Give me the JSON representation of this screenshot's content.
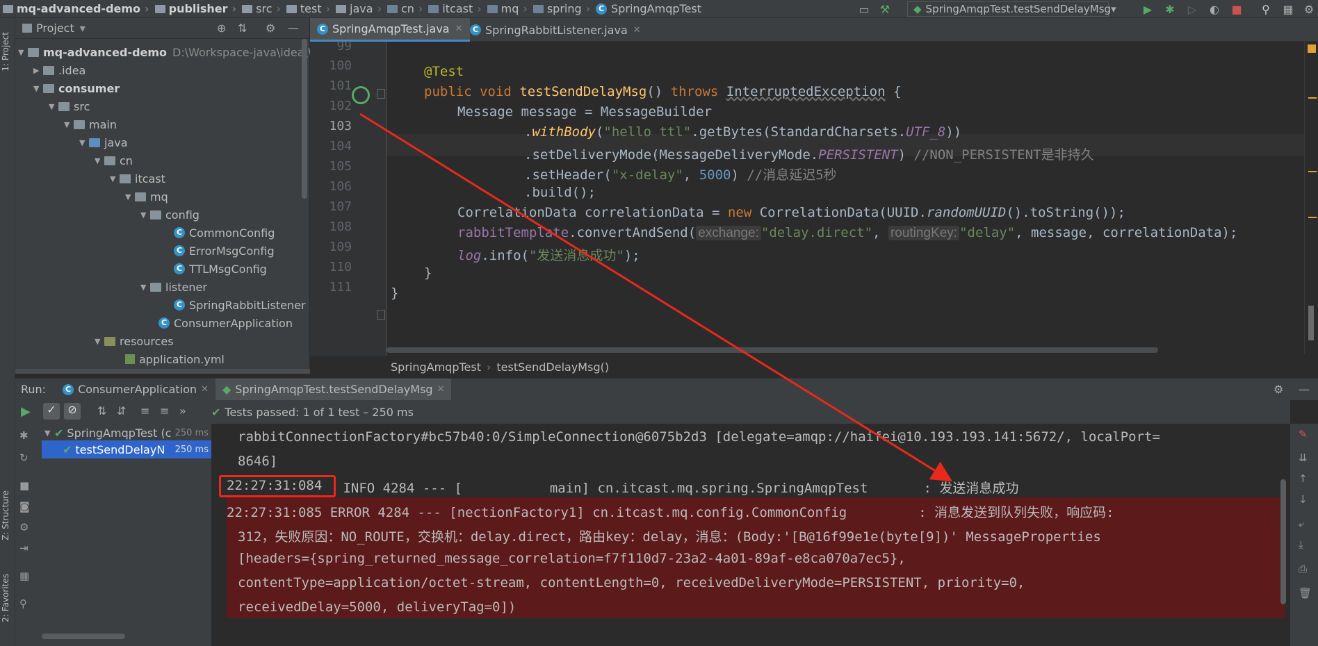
{
  "navbar": {
    "crumbs": [
      "mq-advanced-demo",
      "publisher",
      "src",
      "test",
      "java",
      "cn",
      "itcast",
      "mq",
      "spring",
      "SpringAmqpTest"
    ],
    "run_config": "SpringAmqpTest.testSendDelayMsg"
  },
  "left_strip": {
    "project": "1: Project",
    "structure": "Z: Structure",
    "favorites": "2: Favorites"
  },
  "project": {
    "title": "Project",
    "root": "mq-advanced-demo",
    "root_path": "D:\\Workspace-java\\idea\\Wor",
    "items": [
      {
        "label": ".idea"
      },
      {
        "label": "consumer"
      },
      {
        "label": "src"
      },
      {
        "label": "main"
      },
      {
        "label": "java"
      },
      {
        "label": "cn"
      },
      {
        "label": "itcast"
      },
      {
        "label": "mq"
      },
      {
        "label": "config"
      },
      {
        "label": "CommonConfig"
      },
      {
        "label": "ErrorMsgConfig"
      },
      {
        "label": "TTLMsgConfig"
      },
      {
        "label": "listener"
      },
      {
        "label": "SpringRabbitListener"
      },
      {
        "label": "ConsumerApplication"
      },
      {
        "label": "resources"
      },
      {
        "label": "application.yml"
      }
    ]
  },
  "editor": {
    "tabs": [
      "SpringAmqpTest.java",
      "SpringRabbitListener.java"
    ],
    "line_numbers": [
      "99",
      "100",
      "101",
      "102",
      "103",
      "104",
      "105",
      "106",
      "107",
      "108",
      "109",
      "110",
      "111"
    ],
    "code": {
      "l100": "@Test",
      "l101_public": "public",
      "l101_void": "void",
      "l101_name": "testSendDelayMsg",
      "l101_paren": "()",
      "l101_throws": "throws",
      "l101_exc": "InterruptedException",
      "l101_brace": "{",
      "l102": "Message message = MessageBuilder",
      "l103_a": ".",
      "l103_withBody": "withBody",
      "l103_b": "(",
      "l103_str": "\"hello ttl\"",
      "l103_c": ".getBytes(StandardCharsets.",
      "l103_utf": "UTF_8",
      "l103_d": "))",
      "l104_a": ".setDeliveryMode(MessageDeliveryMode.",
      "l104_const": "PERSISTENT",
      "l104_b": ")",
      "l104_cmt": "//NON_PERSISTENT是非持久",
      "l105_a": ".setHeader(",
      "l105_str": "\"x-delay\"",
      "l105_b": ", ",
      "l105_num": "5000",
      "l105_c": ")",
      "l105_cmt": "//消息延迟5秒",
      "l106": ".build();",
      "l107_a": "CorrelationData correlationData = ",
      "l107_new": "new",
      "l107_b": " CorrelationData(UUID.",
      "l107_m": "randomUUID",
      "l107_c": "().toString());",
      "l108_field": "rabbitTemplate",
      "l108_a": ".convertAndSend(",
      "l108_hint1": "exchange:",
      "l108_str1": "\"delay.direct\"",
      "l108_b": ",",
      "l108_hint2": "routingKey:",
      "l108_str2": "\"delay\"",
      "l108_c": ", message, correlationData);",
      "l109_log": "log",
      "l109_a": ".info(",
      "l109_str": "\"发送消息成功\"",
      "l109_b": ");",
      "l110": "}",
      "l111": "}"
    },
    "breadcrumb": [
      "SpringAmqpTest",
      "testSendDelayMsg()"
    ]
  },
  "run": {
    "label": "Run:",
    "tabs": [
      "ConsumerApplication",
      "SpringAmqpTest.testSendDelayMsg"
    ],
    "status": "Tests passed: 1 of 1 test – 250 ms",
    "tree": [
      {
        "name": "SpringAmqpTest (c",
        "time": "250 ms"
      },
      {
        "name": "testSendDelayN",
        "time": "250 ms"
      }
    ],
    "console": [
      "rabbitConnectionFactory#bc57b40:0/SimpleConnection@6075b2d3 [delegate=amqp://haifei@10.193.193.141:5672/, localPort=",
      "8646]",
      "22:27:31:084",
      " INFO 4284 --- [           main] cn.itcast.mq.spring.SpringAmqpTest       : 发送消息成功",
      "22:27:31:085 ERROR 4284 --- [nectionFactory1] cn.itcast.mq.config.CommonConfig         : 消息发送到队列失败，响应码:",
      "312，失败原因：NO_ROUTE，交换机：delay.direct，路由key：delay，消息：(Body:'[B@16f99e1e(byte[9])' MessageProperties",
      "[headers={spring_returned_message_correlation=f7f110d7-23a2-4a01-89af-e8ca070a7ec5},",
      "contentType=application/octet-stream, contentLength=0, receivedDeliveryMode=PERSISTENT, priority=0,",
      "receivedDelay=5000, deliveryTag=0])"
    ]
  },
  "colors": {
    "accent_red": "#e8291c",
    "error_bg": "#5d1a1a",
    "pass_green": "#59a869"
  }
}
